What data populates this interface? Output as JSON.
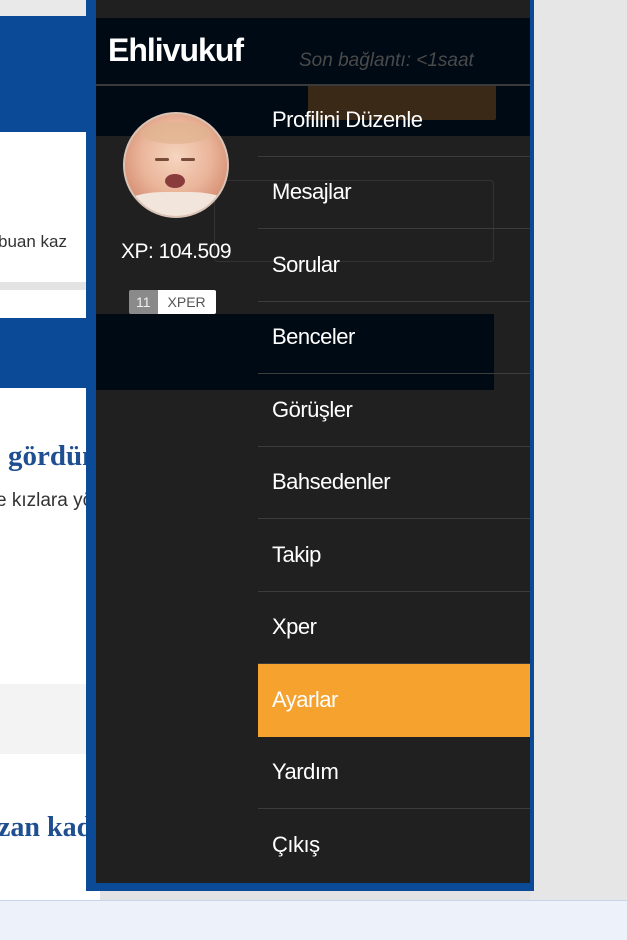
{
  "background": {
    "kazan_fragment": "buan kaz",
    "question1_fragment": "gördünüz mü hiç?",
    "question1_sub_fragment": "e kızlara yönelik soruları görünce",
    "question2_fragment": "zan kadınların yaptığı sizce"
  },
  "drawer": {
    "brand": "Ehlivukuf",
    "ghost_last_seen": "Son bağlantı: <1saat",
    "profile": {
      "xp_label": "XP: 104.509",
      "badge_number": "11",
      "badge_label": "XPER"
    },
    "menu": [
      {
        "id": "profilini-duzenle",
        "label": "Profilini Düzenle",
        "active": false
      },
      {
        "id": "mesajlar",
        "label": "Mesajlar",
        "active": false
      },
      {
        "id": "sorular",
        "label": "Sorular",
        "active": false
      },
      {
        "id": "benceler",
        "label": "Benceler",
        "active": false
      },
      {
        "id": "gorusler",
        "label": "Görüşler",
        "active": false
      },
      {
        "id": "bahsedenler",
        "label": "Bahsedenler",
        "active": false
      },
      {
        "id": "takip",
        "label": "Takip",
        "active": false
      },
      {
        "id": "xper",
        "label": "Xper",
        "active": false
      },
      {
        "id": "ayarlar",
        "label": "Ayarlar",
        "active": true
      },
      {
        "id": "yardim",
        "label": "Yardım",
        "active": false
      },
      {
        "id": "cikis",
        "label": "Çıkış",
        "active": false
      }
    ]
  },
  "colors": {
    "drawer_bg": "#202020",
    "header_bg": "#000a14",
    "active_item": "#f5a22e",
    "frame_blue": "#0a4a97"
  }
}
